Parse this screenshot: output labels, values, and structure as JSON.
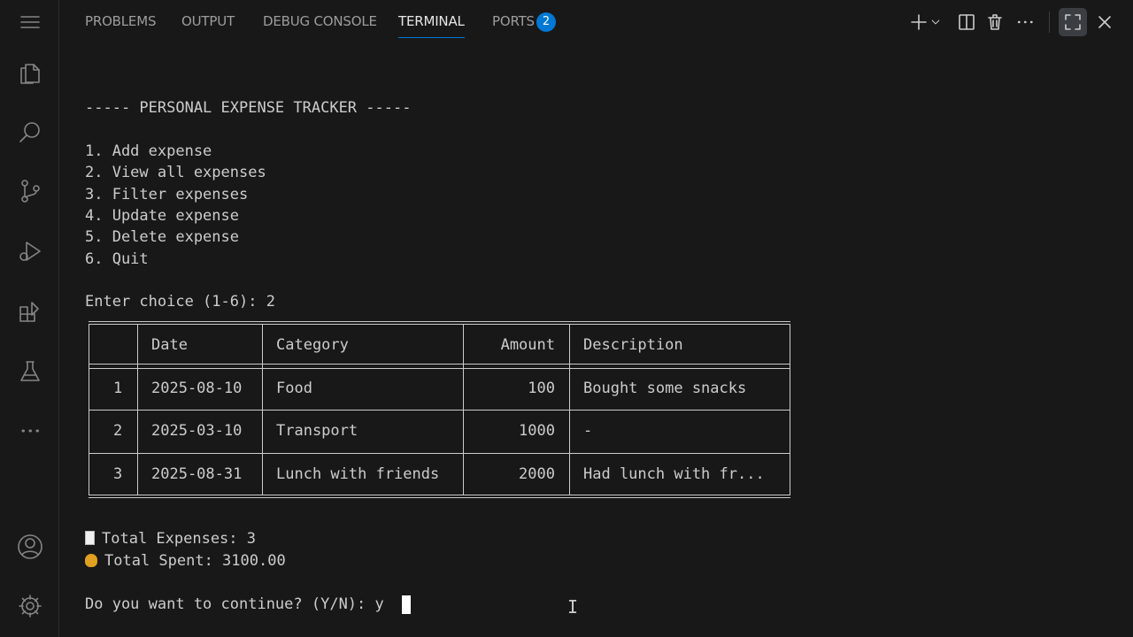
{
  "panel": {
    "tabs": [
      {
        "label": "PROBLEMS"
      },
      {
        "label": "OUTPUT"
      },
      {
        "label": "DEBUG CONSOLE"
      },
      {
        "label": "TERMINAL"
      },
      {
        "label": "PORTS"
      }
    ],
    "ports_badge": "2",
    "actions": [
      "plus-icon",
      "chevron-down-icon",
      "split-icon",
      "trash-icon",
      "more-icon",
      "maximize-icon",
      "close-icon"
    ]
  },
  "activity_bar": {
    "icons": [
      "menu-icon",
      "explorer-icon",
      "search-icon",
      "source-control-icon",
      "run-debug-icon",
      "extensions-icon",
      "testing-icon",
      "more-icon",
      "account-icon",
      "settings-gear-icon"
    ]
  },
  "terminal": {
    "banner": "----- PERSONAL EXPENSE TRACKER -----",
    "menu": [
      "1. Add expense",
      "2. View all expenses",
      "3. Filter expenses",
      "4. Update expense",
      "5. Delete expense",
      "6. Quit"
    ],
    "prompt_choice": "Enter choice (1-6): 2",
    "table": {
      "headers": [
        "",
        "Date",
        "Category",
        "Amount",
        "Description"
      ],
      "rows": [
        [
          "1",
          "2025-08-10",
          "Food",
          "100",
          "Bought some snacks"
        ],
        [
          "2",
          "2025-03-10",
          "Transport",
          "1000",
          "-"
        ],
        [
          "3",
          "2025-08-31",
          "Lunch with friends",
          "2000",
          "Had lunch with fr..."
        ]
      ]
    },
    "total_expenses": "Total Expenses: 3",
    "total_spent": "Total Spent: 3100.00",
    "continue_prompt": "Do you want to continue? (Y/N): y"
  }
}
